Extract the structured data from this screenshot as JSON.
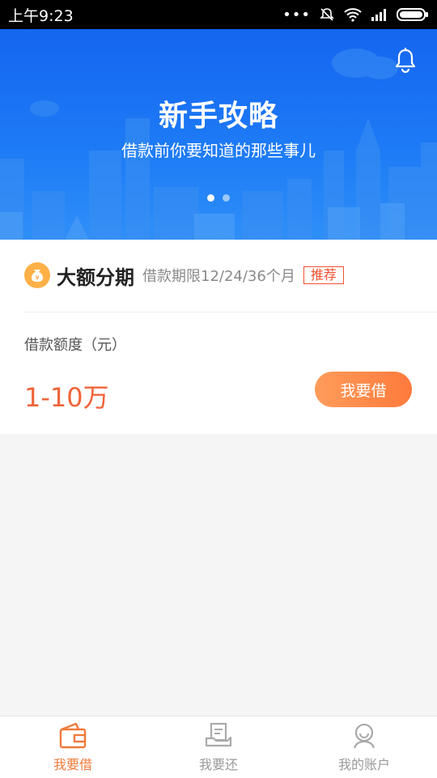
{
  "status_bar": {
    "time": "上午9:23"
  },
  "banner": {
    "title": "新手攻略",
    "subtitle": "借款前你要知道的那些事儿",
    "slide_count": 2,
    "active_slide": 0
  },
  "product": {
    "name": "大额分期",
    "description": "借款期限12/24/36个月",
    "tag": "推荐",
    "amount_label": "借款额度（元）",
    "amount_value": "1-10万",
    "borrow_button": "我要借"
  },
  "tabs": [
    {
      "label": "我要借",
      "icon": "wallet-icon",
      "active": true
    },
    {
      "label": "我要还",
      "icon": "repay-icon",
      "active": false
    },
    {
      "label": "我的账户",
      "icon": "user-icon",
      "active": false
    }
  ],
  "colors": {
    "primary_blue": "#1e7cf6",
    "accent_orange": "#f0643a",
    "tag_red": "#f0502e"
  }
}
